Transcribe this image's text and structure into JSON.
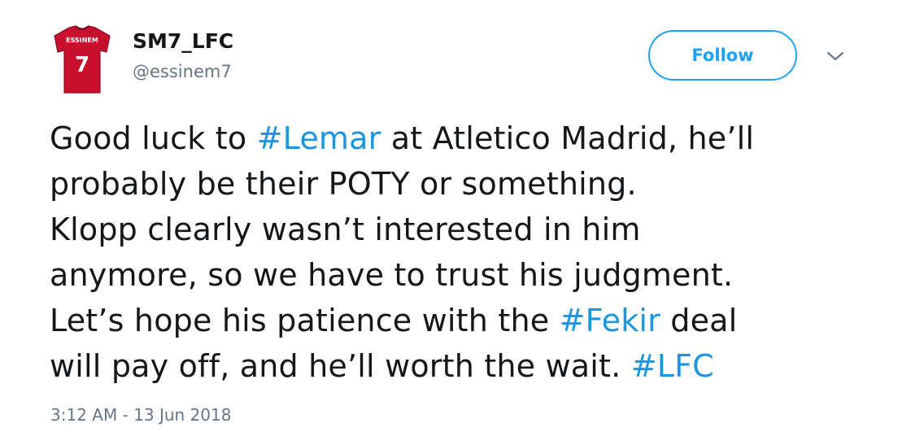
{
  "author": {
    "display_name": "SM7_LFC",
    "handle": "@essinem7",
    "avatar": {
      "icon": "jersey-avatar-icon",
      "jersey_name": "ESSINEM",
      "jersey_number": "7",
      "jersey_color": "#c8102e"
    }
  },
  "actions": {
    "follow_label": "Follow",
    "more_icon": "chevron-down-icon"
  },
  "tweet": {
    "lines": [
      {
        "pre": "Good luck to ",
        "tag": "#Lemar",
        "post": " at Atletico Madrid, he’ll"
      },
      {
        "pre": "probably be their POTY or something.",
        "tag": "",
        "post": ""
      },
      {
        "pre": "Klopp clearly wasn’t interested in him",
        "tag": "",
        "post": ""
      },
      {
        "pre": "anymore, so we have to trust his judgment.",
        "tag": "",
        "post": ""
      },
      {
        "pre": "Let’s hope his patience with the ",
        "tag": "#Fekir",
        "post": " deal"
      },
      {
        "pre": "will pay off, and he’ll worth the wait. ",
        "tag": "#LFC",
        "post": ""
      }
    ],
    "timestamp": "3:12 AM - 13 Jun 2018"
  },
  "colors": {
    "accent": "#1da1f2",
    "hashtag": "#1b95e0",
    "text": "#14171a",
    "muted": "#657786"
  }
}
